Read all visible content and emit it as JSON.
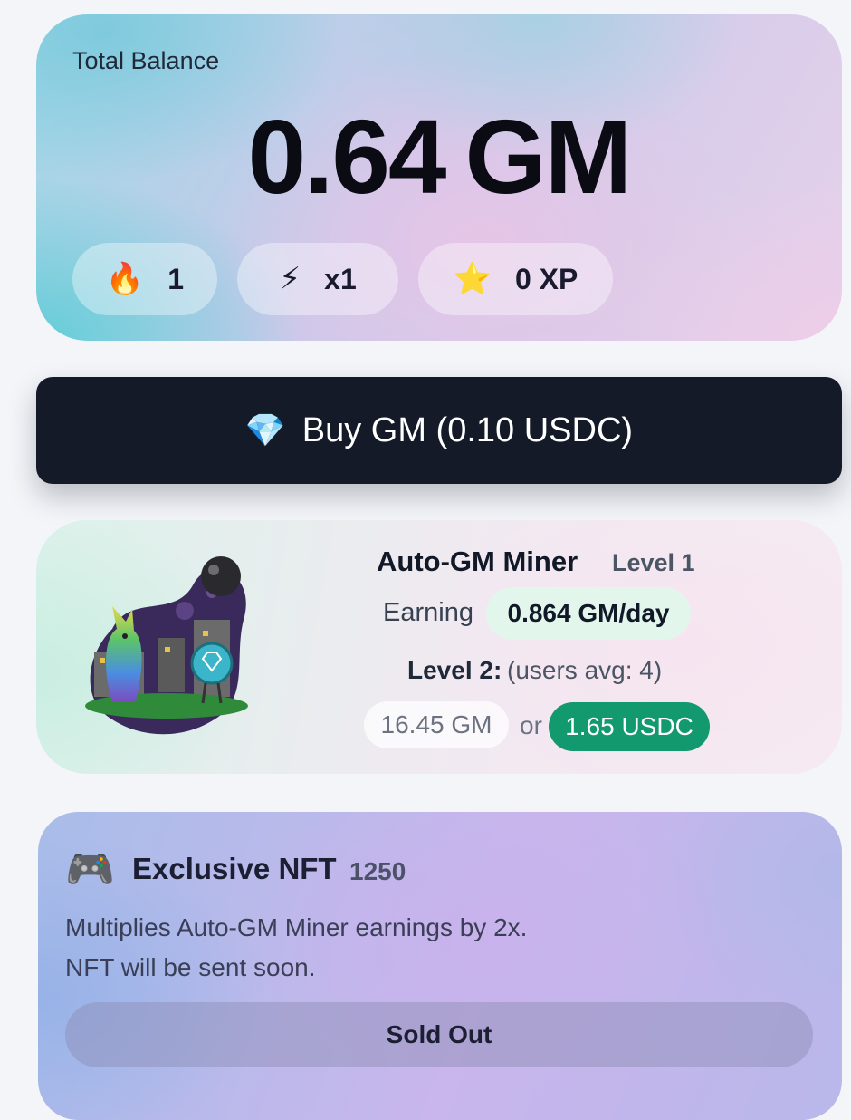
{
  "balance": {
    "label": "Total Balance",
    "amount": "0.64",
    "unit": "GM"
  },
  "stats": {
    "streak": {
      "icon": "fire-icon",
      "emoji": "🔥",
      "value": "1"
    },
    "multiplier": {
      "icon": "lightning-icon",
      "emoji": "⚡",
      "value": "x1"
    },
    "xp": {
      "icon": "star-icon",
      "emoji": "⭐",
      "value": "0 XP"
    }
  },
  "buy": {
    "icon": "diamond-icon",
    "emoji": "💎",
    "label": "Buy GM (0.10 USDC)"
  },
  "miner": {
    "title": "Auto-GM Miner",
    "level": "Level 1",
    "earning_label": "Earning",
    "earning_rate": "0.864 GM/day",
    "next_level_label": "Level 2:",
    "next_level_note": "(users avg: 4)",
    "price_gm": "16.45 GM",
    "or_text": "or",
    "price_usdc": "1.65 USDC"
  },
  "nft": {
    "icon": "gamepad-icon",
    "emoji": "🎮",
    "title": "Exclusive NFT",
    "count": "1250",
    "description_line1": "Multiplies Auto-GM Miner earnings by 2x.",
    "description_line2": "NFT will be sent soon.",
    "button_label": "Sold Out"
  },
  "colors": {
    "buy_button_bg": "#141a28",
    "usdc_button_bg": "#12996d",
    "earning_pill_bg": "#e2f6ec"
  }
}
